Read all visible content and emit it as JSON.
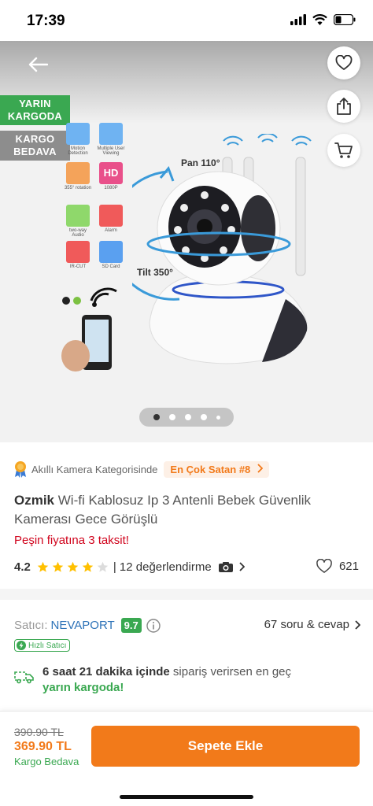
{
  "status_bar": {
    "time": "17:39"
  },
  "hero": {
    "badge_next_day": "YARIN KARGODA",
    "badge_free_shipping": "KARGO BEDAVA",
    "features": [
      {
        "label": "Motion Detection",
        "color": "#6fb3f2"
      },
      {
        "label": "Multiple User Viewing",
        "color": "#6fb3f2"
      },
      {
        "label": "355° rotation",
        "color": "#f4a35a"
      },
      {
        "label": "1080P",
        "color": "#e9508a"
      },
      {
        "label": "two-way Audio",
        "color": "#8fd86b"
      },
      {
        "label": "Alarm",
        "color": "#f05a5a"
      },
      {
        "label": "IR-CUT",
        "color": "#f05a5a"
      },
      {
        "label": "SD Card",
        "color": "#5aa0f0"
      }
    ],
    "hd_text": "HD",
    "pan_label": "Pan  110°",
    "tilt_label": "Tilt  350°",
    "dots_total": 5,
    "dots_active": 1
  },
  "category": {
    "text": "Akıllı Kamera Kategorisinde",
    "best_seller": "En Çok Satan #8"
  },
  "product": {
    "brand": "Ozmik",
    "name": "Wi-fi Kablosuz Ip 3 Antenli Bebek Güvenlik Kamerası Gece Görüşlü",
    "installment": "Peşin fiyatına 3 taksit!",
    "rating": "4.2",
    "rating_value": 4.2,
    "reviews": "| 12 değerlendirme",
    "favorites": "621"
  },
  "seller": {
    "label": "Satıcı:",
    "name": "NEVAPORT",
    "score": "9.7",
    "qa": "67 soru & cevap",
    "fast_tag": "Hızlı Satıcı"
  },
  "delivery": {
    "bold": "6 saat 21 dakika içinde",
    "rest": " sipariş verirsen en geç",
    "green": "yarın kargoda!"
  },
  "bottom": {
    "old_price": "390.90 TL",
    "new_price": "369.90 TL",
    "free_shipping": "Kargo Bedava",
    "add_to_cart": "Sepete Ekle"
  },
  "colors": {
    "accent": "#f27a1a",
    "green": "#3aa851",
    "link": "#2e73b8",
    "red": "#d0021b"
  }
}
